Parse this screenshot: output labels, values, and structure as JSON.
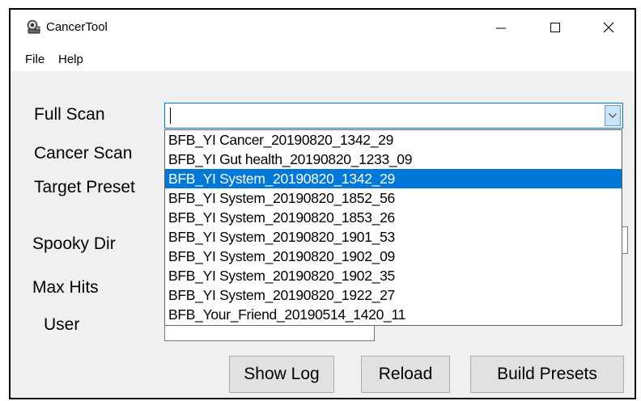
{
  "window": {
    "title": "CancerTool"
  },
  "menu": {
    "file": "File",
    "help": "Help"
  },
  "labels": {
    "full_scan": "Full Scan",
    "cancer_scan": "Cancer Scan",
    "target_preset": "Target Preset",
    "spooky_dir": "Spooky Dir",
    "max_hits": "Max Hits",
    "user": "User"
  },
  "full_scan_combo": {
    "value": "",
    "selected_index": 2,
    "options": [
      "BFB_YI Cancer_20190820_1342_29",
      "BFB_YI Gut health_20190820_1233_09",
      "BFB_YI System_20190820_1342_29",
      "BFB_YI System_20190820_1852_56",
      "BFB_YI System_20190820_1853_26",
      "BFB_YI System_20190820_1901_53",
      "BFB_YI System_20190820_1902_09",
      "BFB_YI System_20190820_1902_35",
      "BFB_YI System_20190820_1922_27",
      "BFB_Your_Friend_20190514_1420_11"
    ]
  },
  "buttons": {
    "show_log": "Show Log",
    "reload": "Reload",
    "build_presets": "Build Presets"
  },
  "icons": {
    "app": "app-icon",
    "minimize": "minimize-icon",
    "maximize": "maximize-icon",
    "close": "close-icon",
    "dropdown": "chevron-down-icon"
  },
  "colors": {
    "selection": "#0078d7",
    "window_bg": "#f0f0f0",
    "button_bg": "#e1e1e1"
  }
}
